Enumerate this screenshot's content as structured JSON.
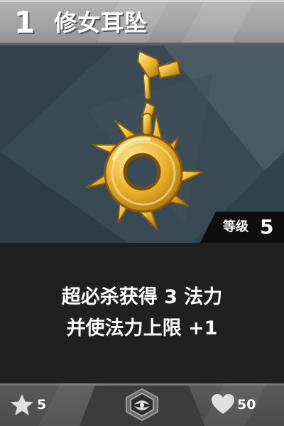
{
  "card": {
    "number": "1",
    "name": "修女耳坠",
    "item_icon": "golden-sun-earring-icon",
    "level_label": "等级",
    "level_value": "5",
    "description_lines": [
      "超必杀获得 3 法力",
      "并使法力上限 +1"
    ],
    "cost": "5",
    "cost_icon": "star-icon",
    "rarity_icon": "emblem-icon",
    "health": "50",
    "health_icon": "heart-icon"
  },
  "colors": {
    "header_bg": "#a6a6a6",
    "art_bg": "#3a4a54",
    "gold": "#e8b52c",
    "panel_dark": "#202020",
    "footer_bg": "#555555"
  }
}
